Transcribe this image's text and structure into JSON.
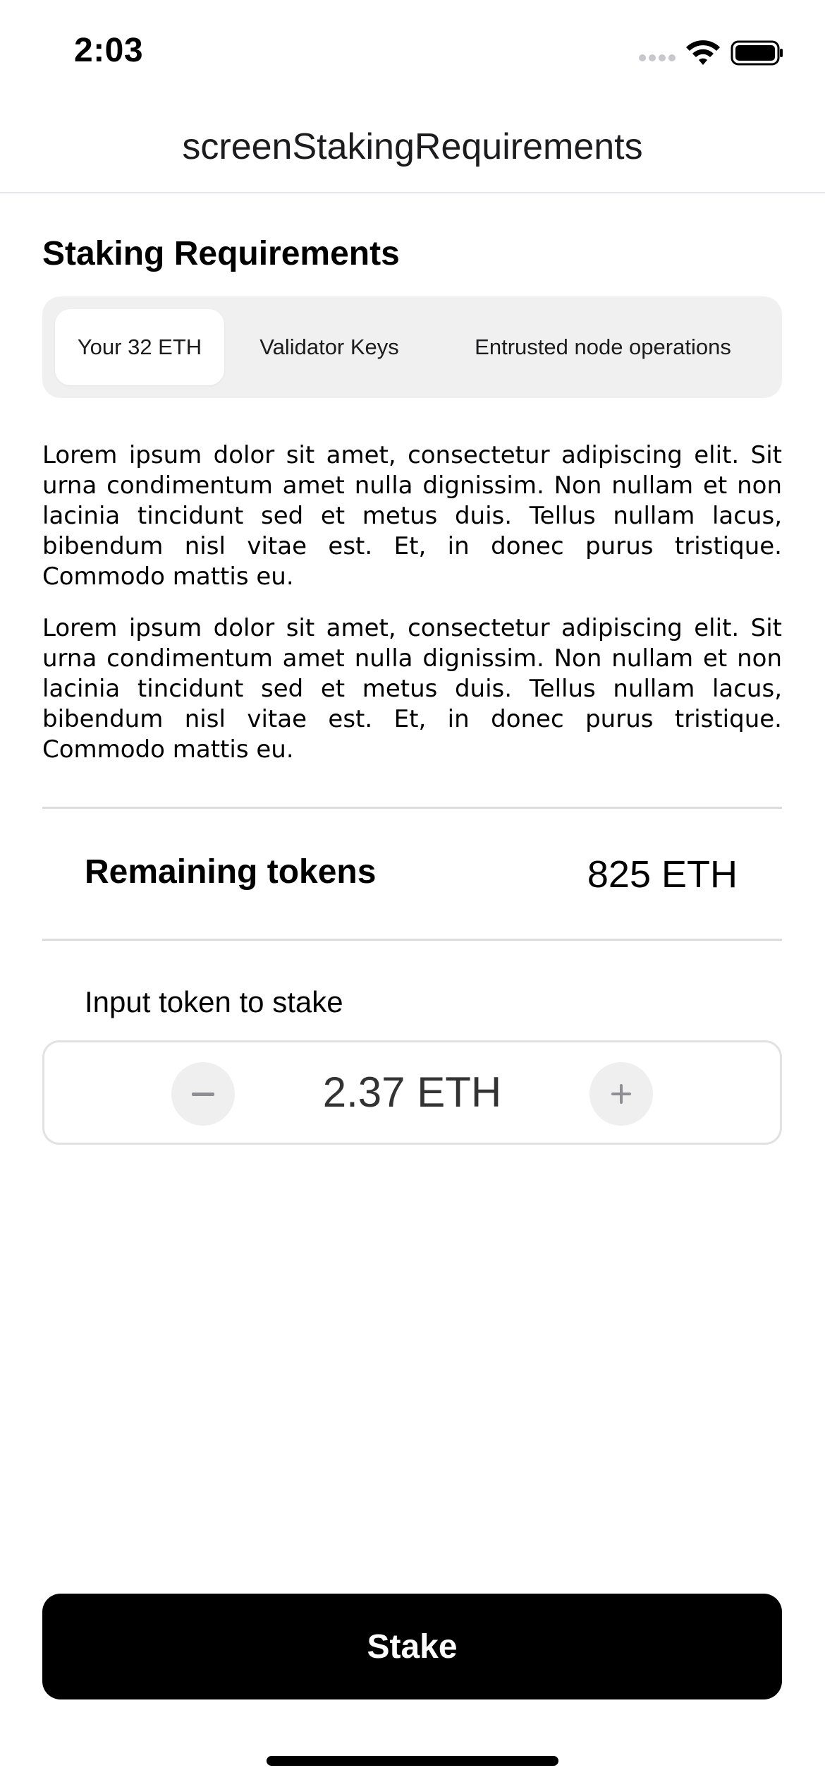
{
  "status_bar": {
    "time": "2:03",
    "signal_icon": "cellular-signal-icon",
    "wifi_icon": "wifi-icon",
    "battery_icon": "battery-icon"
  },
  "header": {
    "title": "screenStakingRequirements"
  },
  "section": {
    "title": "Staking Requirements"
  },
  "tabs": [
    {
      "label": "Your 32 ETH",
      "active": true
    },
    {
      "label": "Validator Keys",
      "active": false
    },
    {
      "label": "Entrusted node operations",
      "active": false
    }
  ],
  "paragraphs": [
    "Lorem ipsum dolor sit amet, consectetur adipiscing elit. Sit urna condimentum amet nulla dignissim. Non nullam et non lacinia tincidunt sed et metus duis. Tellus nullam lacus, bibendum nisl vitae est. Et, in donec purus tristique. Commodo mattis eu.",
    "Lorem ipsum dolor sit amet, consectetur adipiscing elit. Sit urna condimentum amet nulla dignissim. Non nullam et non lacinia tincidunt sed et metus duis. Tellus nullam lacus, bibendum nisl vitae est. Et, in donec purus tristique. Commodo mattis eu."
  ],
  "remaining": {
    "label": "Remaining tokens",
    "value": "825 ETH"
  },
  "stake_input": {
    "label": "Input token to stake",
    "value": "2.37 ETH",
    "minus_icon": "minus-icon",
    "plus_icon": "plus-icon"
  },
  "actions": {
    "stake_label": "Stake"
  },
  "colors": {
    "accent": "#000000",
    "segment_bg": "#f0f0f0",
    "stepper_button_bg": "#efefef",
    "divider": "#dcdcdc"
  }
}
